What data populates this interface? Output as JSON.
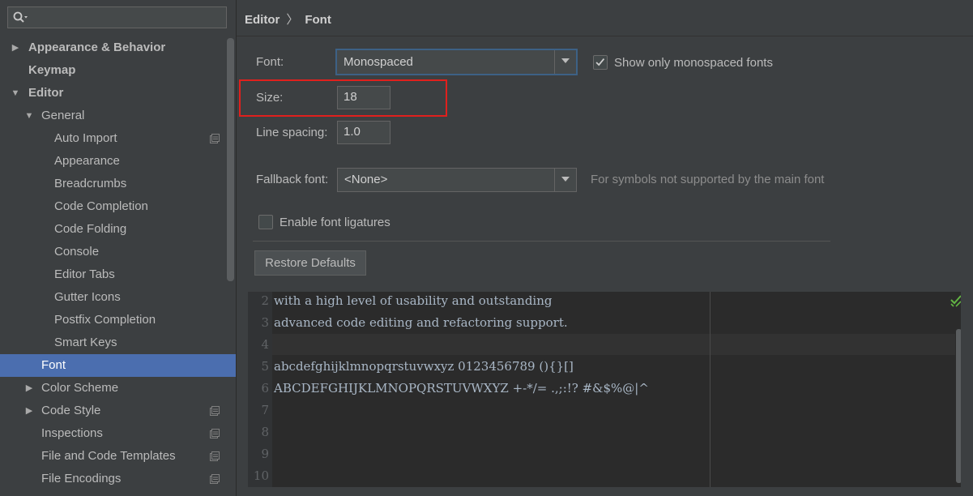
{
  "sidebar": {
    "search_placeholder": "",
    "items": [
      {
        "label": "Appearance & Behavior",
        "level": 0,
        "arrow": "collapsed",
        "bold": true
      },
      {
        "label": "Keymap",
        "level": 0,
        "arrow": "none",
        "bold": true
      },
      {
        "label": "Editor",
        "level": 0,
        "arrow": "expanded",
        "bold": true
      },
      {
        "label": "General",
        "level": 1,
        "arrow": "expanded"
      },
      {
        "label": "Auto Import",
        "level": 2,
        "project_icon": true
      },
      {
        "label": "Appearance",
        "level": 2
      },
      {
        "label": "Breadcrumbs",
        "level": 2
      },
      {
        "label": "Code Completion",
        "level": 2
      },
      {
        "label": "Code Folding",
        "level": 2
      },
      {
        "label": "Console",
        "level": 2
      },
      {
        "label": "Editor Tabs",
        "level": 2
      },
      {
        "label": "Gutter Icons",
        "level": 2
      },
      {
        "label": "Postfix Completion",
        "level": 2
      },
      {
        "label": "Smart Keys",
        "level": 2
      },
      {
        "label": "Font",
        "level": 1,
        "selected": true
      },
      {
        "label": "Color Scheme",
        "level": 1,
        "arrow": "collapsed"
      },
      {
        "label": "Code Style",
        "level": 1,
        "arrow": "collapsed",
        "project_icon": true
      },
      {
        "label": "Inspections",
        "level": 1,
        "project_icon": true
      },
      {
        "label": "File and Code Templates",
        "level": 1,
        "project_icon": true
      },
      {
        "label": "File Encodings",
        "level": 1,
        "project_icon": true
      }
    ]
  },
  "breadcrumb": {
    "parent": "Editor",
    "separator": "〉",
    "current": "Font"
  },
  "form": {
    "font_label": "Font:",
    "font_value": "Monospaced",
    "monospaced_only_label": "Show only monospaced fonts",
    "monospaced_only_checked": true,
    "size_label": "Size:",
    "size_value": "18",
    "line_spacing_label": "Line spacing:",
    "line_spacing_value": "1.0",
    "fallback_label": "Fallback font:",
    "fallback_value": "<None>",
    "fallback_hint": "For symbols not supported by the main font",
    "ligatures_label": "Enable font ligatures",
    "ligatures_checked": false,
    "restore_button": "Restore Defaults"
  },
  "preview": {
    "lines": [
      {
        "num": "2",
        "text": "with a high level of usability and outstanding"
      },
      {
        "num": "3",
        "text": "advanced code editing and refactoring support."
      },
      {
        "num": "4",
        "text": ""
      },
      {
        "num": "5",
        "text": "abcdefghijklmnopqrstuvwxyz 0123456789 (){}[]"
      },
      {
        "num": "6",
        "text": "ABCDEFGHIJKLMNOPQRSTUVWXYZ +-*/= .,;:!? #&$%@|^"
      },
      {
        "num": "7",
        "text": ""
      },
      {
        "num": "8",
        "text": ""
      },
      {
        "num": "9",
        "text": ""
      },
      {
        "num": "10",
        "text": ""
      }
    ]
  },
  "colors": {
    "background": "#3c3f41",
    "selection": "#4b6eaf",
    "highlight_box": "#e0201d",
    "editor_bg": "#2b2b2b",
    "check_green": "#62b543"
  }
}
